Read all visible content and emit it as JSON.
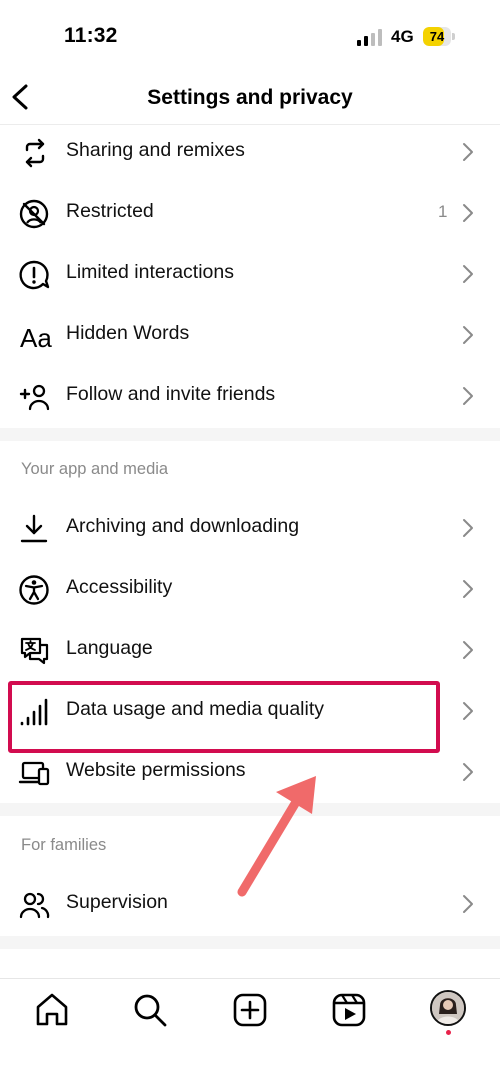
{
  "status_bar": {
    "time": "11:32",
    "network": "4G",
    "battery_level": "74",
    "battery_fraction": 0.74,
    "battery_color": "#f4d200"
  },
  "header": {
    "title": "Settings and privacy",
    "back_icon": "chevron-left-icon"
  },
  "sections": {
    "top_items": [
      {
        "label": "Sharing and remixes",
        "icon": "sharing-remix-icon"
      },
      {
        "label": "Restricted",
        "icon": "restricted-icon",
        "count": "1"
      },
      {
        "label": "Limited interactions",
        "icon": "limited-interactions-icon"
      },
      {
        "label": "Hidden Words",
        "icon": "hidden-words-icon"
      },
      {
        "label": "Follow and invite friends",
        "icon": "add-person-icon"
      }
    ],
    "app_media": {
      "header": "Your app and media",
      "items": [
        {
          "label": "Archiving and downloading",
          "icon": "download-icon"
        },
        {
          "label": "Accessibility",
          "icon": "accessibility-icon"
        },
        {
          "label": "Language",
          "icon": "language-icon"
        },
        {
          "label": "Data usage and media quality",
          "icon": "signal-bars-icon",
          "highlighted": true
        },
        {
          "label": "Website permissions",
          "icon": "devices-icon"
        }
      ]
    },
    "families": {
      "header": "For families",
      "items": [
        {
          "label": "Supervision",
          "icon": "supervision-icon"
        }
      ]
    }
  },
  "annotation": {
    "highlight_color": "#d20c4f",
    "arrow_color": "#f06a6a"
  },
  "tab_bar": {
    "items": [
      "home-icon",
      "search-icon",
      "create-icon",
      "reels-icon",
      "profile-avatar"
    ]
  }
}
